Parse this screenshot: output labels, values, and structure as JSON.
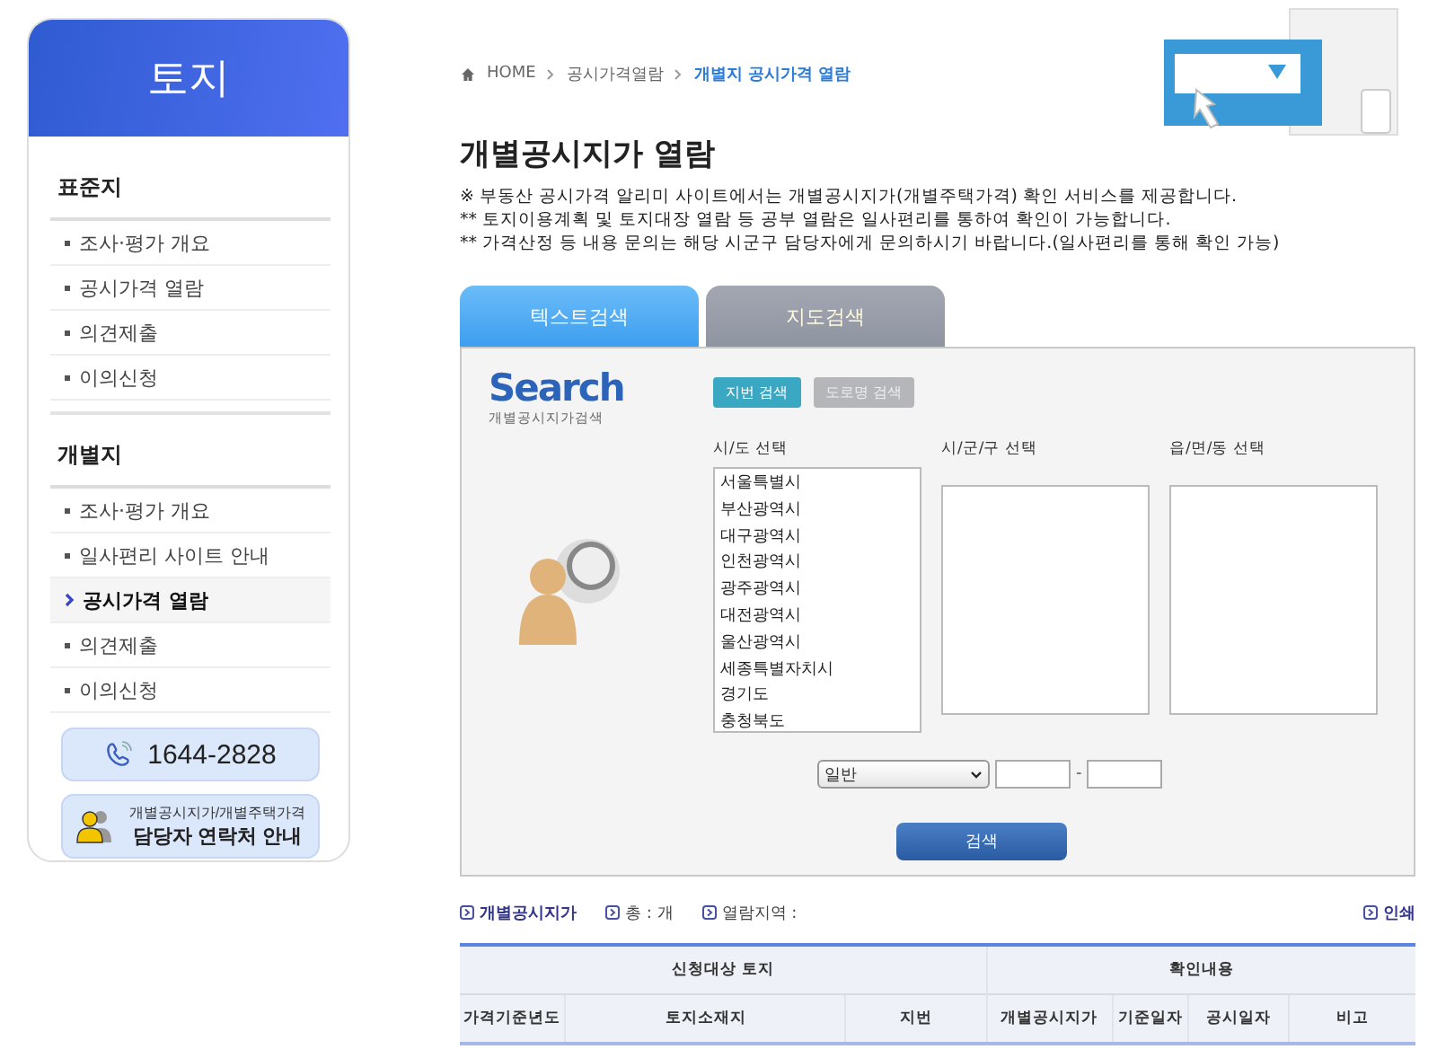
{
  "sidebar": {
    "title": "토지",
    "groups": [
      {
        "heading": "표준지",
        "items": [
          {
            "label": "조사·평가 개요",
            "selected": false
          },
          {
            "label": "공시가격 열람",
            "selected": false
          },
          {
            "label": "의견제출",
            "selected": false
          },
          {
            "label": "이의신청",
            "selected": false
          }
        ]
      },
      {
        "heading": "개별지",
        "items": [
          {
            "label": "조사·평가 개요",
            "selected": false
          },
          {
            "label": "일사편리 사이트 안내",
            "selected": false
          },
          {
            "label": "공시가격 열람",
            "selected": true
          },
          {
            "label": "의견제출",
            "selected": false
          },
          {
            "label": "이의신청",
            "selected": false
          }
        ]
      }
    ],
    "phone": "1644-2828",
    "contact": {
      "line1": "개별공시지가/개별주택가격",
      "line2": "담당자 연락처 안내"
    }
  },
  "breadcrumb": [
    {
      "label": "HOME",
      "current": false
    },
    {
      "label": "공시가격열람",
      "current": false
    },
    {
      "label": "개별지 공시가격 열람",
      "current": true
    }
  ],
  "page_title": "개별공시지가 열람",
  "notes": [
    "※ 부동산 공시가격 알리미 사이트에서는 개별공시지가(개별주택가격) 확인 서비스를 제공합니다.",
    "** 토지이용계획 및 토지대장 열람 등 공부 열람은 일사편리를 통하여 확인이 가능합니다.",
    "** 가격산정 등 내용 문의는 해당 시군구 담당자에게 문의하시기 바랍니다.(일사편리를 통해 확인 가능)"
  ],
  "tabs": [
    {
      "label": "텍스트검색",
      "selected": true
    },
    {
      "label": "지도검색",
      "selected": false
    }
  ],
  "search": {
    "logo_title": "Search",
    "logo_subtitle": "개별공시지가검색",
    "modes": [
      {
        "label": "지번 검색",
        "selected": true
      },
      {
        "label": "도로명 검색",
        "selected": false
      }
    ],
    "lists": [
      {
        "label": "시/도 선택",
        "options": [
          "서울특별시",
          "부산광역시",
          "대구광역시",
          "인천광역시",
          "광주광역시",
          "대전광역시",
          "울산광역시",
          "세종특별자치시",
          "경기도",
          "충청북도"
        ]
      },
      {
        "label": "시/군/구 선택"
      },
      {
        "label": "읍/면/동 선택"
      }
    ],
    "land_type": "일반",
    "separator": "-",
    "submit": "검색"
  },
  "summary": {
    "items": [
      "개별공시지가",
      "총 : 개",
      "열람지역 :"
    ],
    "print": "인쇄"
  },
  "table": {
    "groups": [
      {
        "label": "신청대상 토지",
        "columns": [
          "가격기준년도",
          "토지소재지",
          "지번"
        ]
      },
      {
        "label": "확인내용",
        "columns": [
          "개별공시지가",
          "기준일자",
          "공시일자",
          "비고"
        ]
      }
    ]
  }
}
